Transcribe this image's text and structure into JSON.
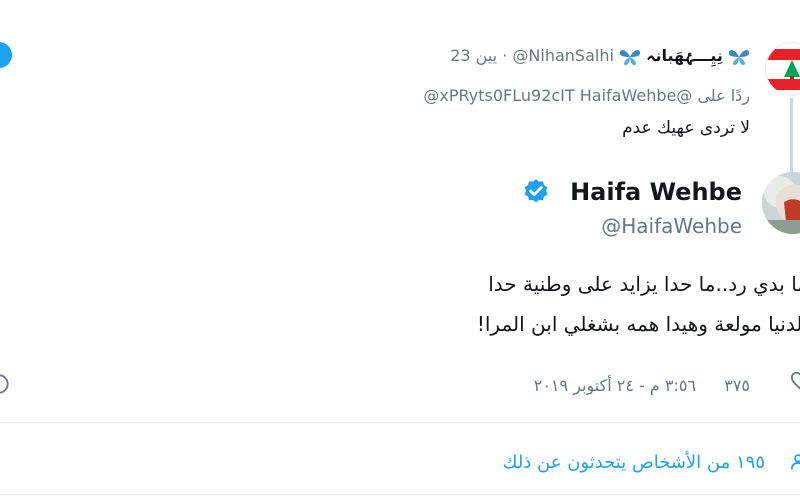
{
  "reply": {
    "timestamp": "23 يين",
    "handle": "@NihanSalhi",
    "name": "نِيِـــۂهَبانہ",
    "replying_to_prefix": "ردًا على",
    "replying_to_handles": "@xPRyts0FLu92cIT HaifaWehbe@",
    "text": "لا تردى عهيك عدم"
  },
  "tweet": {
    "name": "Haifa Wehbe",
    "handle": "@HaifaWehbe",
    "line1": "ما بدي رد..ما حدا يزايد على وطنية حدا",
    "line2": "الدنيا مولعة وهيدا همه بشغلي ابن المرا!",
    "time": "٣:٥٦ م",
    "date": "٢٤ أكتوبر ٢٠١٩",
    "likes": "٣٧٥",
    "people_talking": "١٩٥ من الأشخاص يتحدثون عن ذلك"
  },
  "colors": {
    "accent": "#1da1f2",
    "muted": "#657786",
    "text": "#14171a",
    "divider": "#e6ecf0"
  }
}
